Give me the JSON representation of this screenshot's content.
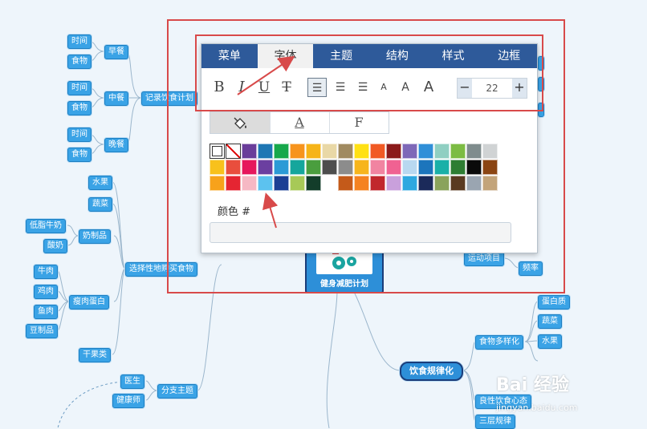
{
  "mindmap": {
    "central": "健身减肥计划",
    "left": {
      "record": "记录饮食计划",
      "breakfast": "早餐",
      "lunch": "中餐",
      "dinner": "晚餐",
      "time": "时间",
      "food": "食物",
      "select": "选择性地购买食物",
      "fruit": "水果",
      "veg": "蔬菜",
      "dairy": "奶制品",
      "lowfat": "低脂牛奶",
      "yogurt": "酸奶",
      "protein": "瘦肉蛋白",
      "beef": "牛肉",
      "chicken": "鸡肉",
      "fish": "鱼肉",
      "tofu": "豆制品",
      "nuts": "干果类",
      "branch": "分支主题",
      "doctor": "医生",
      "coach": "健康师"
    },
    "right": {
      "regular": "饮食规律化",
      "diverse": "食物多样化",
      "protein": "蛋白质",
      "veg": "蔬菜",
      "fruit": "水果",
      "sport": "运动项目",
      "freq": "频率",
      "selective": "良性饮食心态",
      "three": "三层规律"
    }
  },
  "dialog": {
    "tabs": [
      "菜单",
      "字体",
      "主题",
      "结构",
      "样式",
      "边框"
    ],
    "active_tab": "字体",
    "toolbar": {
      "bold": "B",
      "italic": "I",
      "underline": "U",
      "strike": "T",
      "align1": "☰",
      "align2": "☰",
      "align3": "☰",
      "size_small": "A",
      "size_mid": "A",
      "size_large": "A",
      "minus": "−",
      "font_size": "22",
      "plus": "+"
    },
    "subtabs": [
      "",
      "A",
      "F"
    ],
    "color_label": "颜色 #",
    "color_value": "",
    "palette_rows": [
      [
        "#ffffff",
        "#ffffff",
        "#6a3d9a",
        "#1f77b4",
        "#17a84b",
        "#f7941d",
        "#f6b418",
        "#e9d8a6",
        "#a08a60",
        "#ffe114",
        "#f15a24",
        "#8b1a1a",
        "#7e68b8",
        "#2f8fd8",
        "#8fcfc2",
        "#7cbc43",
        "#7f8c8d",
        "#d0d3d4"
      ],
      [
        "#f8c11c",
        "#e94e3d",
        "#e6175c",
        "#6b3fa0",
        "#2b9ad6",
        "#15a69c",
        "#4a9e3e",
        "#4d4d4d",
        "#8c8c8c",
        "#f7b51c",
        "#f184a1",
        "#f06292",
        "#b8d8f0",
        "#1c75bc",
        "#1ab0a8",
        "#2e7d32",
        "#0a0a0a",
        "#8b4513"
      ],
      [
        "#f7a21b",
        "#e52532",
        "#f6b8c4",
        "#5cc2ef",
        "#1c3f94",
        "#a7c957",
        "#133d2a",
        "#ffffff",
        "#c45a1a",
        "#f58220",
        "#c1272d",
        "#c9a0dc",
        "#2ea8e0",
        "#1b2a5a",
        "#8aa35b",
        "#5a3a21",
        "#9aa5b1",
        "#c3a47a"
      ]
    ]
  },
  "watermark": {
    "text": "Bai 经验",
    "url": "jingyan.baidu.com"
  },
  "colors": {
    "node": "#3aa3e6",
    "tab_bar": "#2e5a9a",
    "highlight": "#d84a4a"
  }
}
